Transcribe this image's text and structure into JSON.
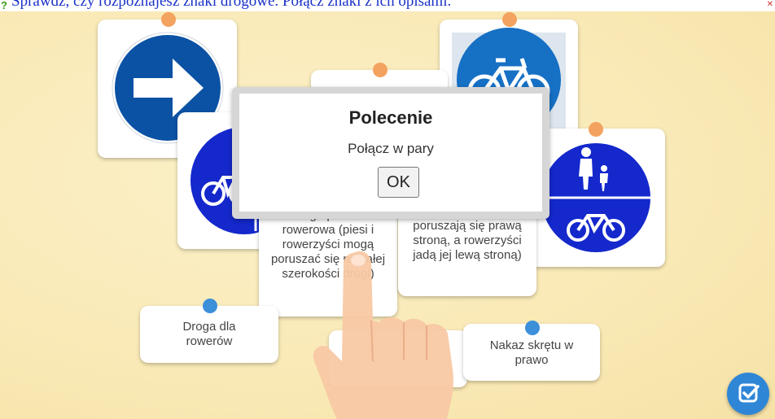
{
  "header": {
    "title": "Sprawdź, czy rozpoznajesz znaki drogowe. Połącz znaki z ich opisami."
  },
  "icons": {
    "help": "question-mark-icon",
    "close": "close-icon"
  },
  "dialog": {
    "title": "Polecenie",
    "message": "Połącz w pary",
    "ok_label": "OK"
  },
  "cards": {
    "pedestrian_bike_shared": "Droga pieszo-rowerowa (piesi i rowerzyści mogą poruszać się na całej szerokości drogi)",
    "pedestrian_bike_separated": "Droga pieszo-rowerowa (piesi poruszają się prawą stroną, a rowerzyści jadą jej lewą stroną)",
    "bike_path": "Droga dla rowerów",
    "turn_right": "Nakaz skrętu w prawo"
  },
  "colors": {
    "sign_blue": "#0b52a4",
    "pin_orange": "#f4a25f",
    "pin_blue": "#3c8fd9",
    "check_button": "#2f86d6",
    "skin": "#f8c8a4"
  }
}
